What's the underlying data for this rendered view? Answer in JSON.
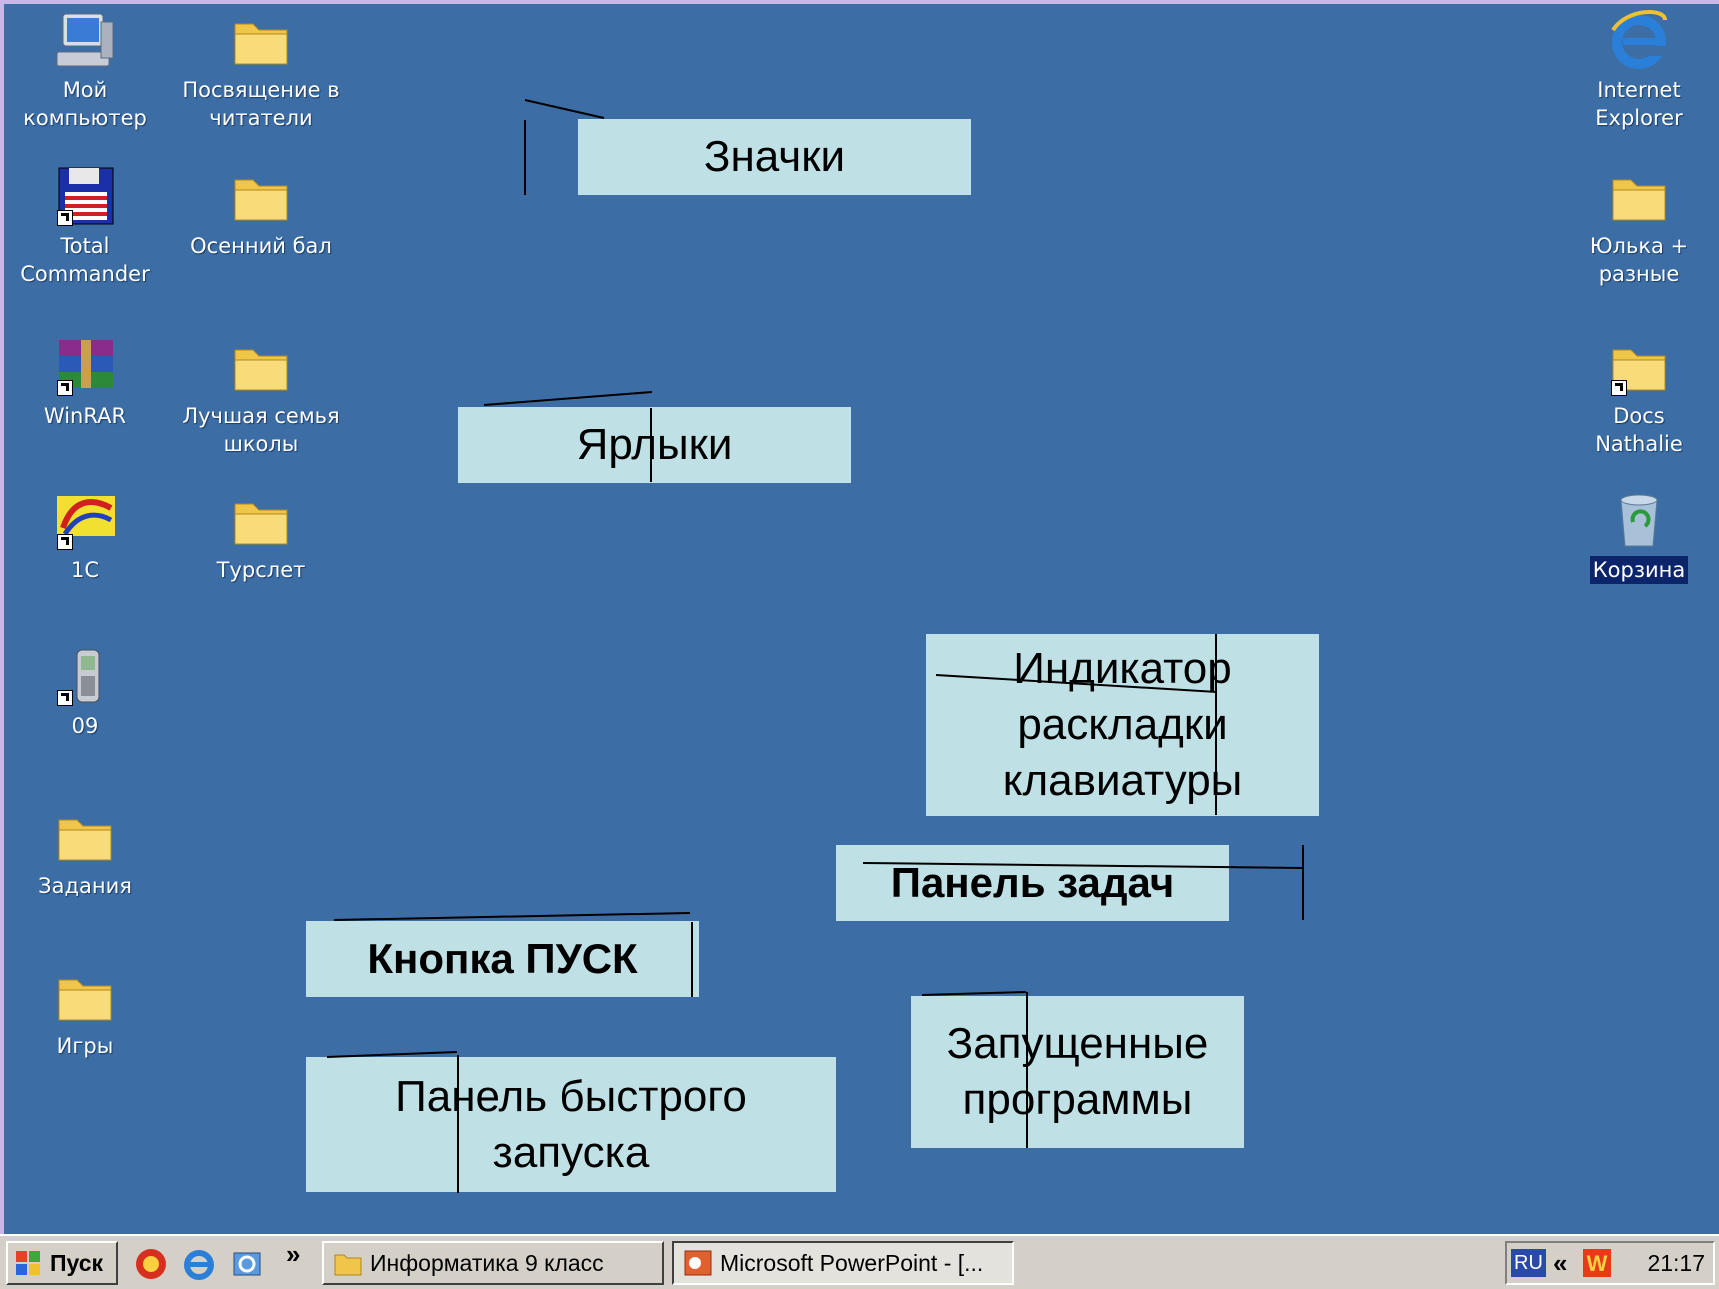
{
  "desktop": {
    "left_icons": [
      {
        "label": "Мой\nкомпьютер",
        "icon": "my-computer-icon"
      },
      {
        "label": "Total\nCommander",
        "icon": "total-commander-icon"
      },
      {
        "label": "WinRAR",
        "icon": "winrar-icon"
      },
      {
        "label": "1С",
        "icon": "1c-icon"
      },
      {
        "label": "09",
        "icon": "phone-icon"
      },
      {
        "label": "Задания",
        "icon": "folder-icon"
      },
      {
        "label": "Игры",
        "icon": "folder-icon"
      }
    ],
    "middle_icons": [
      {
        "label": "Посвящение в\nчитатели",
        "icon": "folder-icon"
      },
      {
        "label": "Осенний бал",
        "icon": "folder-icon"
      },
      {
        "label": "Лучшая семья\nшколы",
        "icon": "folder-icon"
      },
      {
        "label": "Турслет",
        "icon": "folder-icon"
      }
    ],
    "right_icons": [
      {
        "label": "Internet\nExplorer",
        "icon": "internet-explorer-icon"
      },
      {
        "label": "Юлька +\nразные",
        "icon": "folder-icon"
      },
      {
        "label": "Docs Nathalie",
        "icon": "folder-shortcut-icon"
      },
      {
        "label": "Корзина",
        "icon": "recycle-bin-icon"
      }
    ]
  },
  "callouts": {
    "icons": "Значки",
    "shortcuts": "Ярлыки",
    "keyboard_indicator": "Индикатор\nраскладки\nклавиатуры",
    "taskbar": "Панель задач",
    "start_button": "Кнопка ПУСК",
    "running_programs": "Запущенные\nпрограммы",
    "quick_launch": "Панель быстрого\nзапуска"
  },
  "taskbar": {
    "start_label": "Пуск",
    "quick_launch_more": "»",
    "tasks": [
      {
        "label": "Информатика 9 класс",
        "icon": "folder-icon"
      },
      {
        "label": "Microsoft PowerPoint - [...",
        "icon": "powerpoint-icon"
      }
    ],
    "tray": {
      "language": "RU",
      "expand": "«",
      "clock": "21:17"
    }
  },
  "colors": {
    "desktop": "#3c6ea5",
    "callout": "#bfe0e4",
    "taskbar": "#d4d0c8",
    "frame": "#c8b8e8"
  }
}
